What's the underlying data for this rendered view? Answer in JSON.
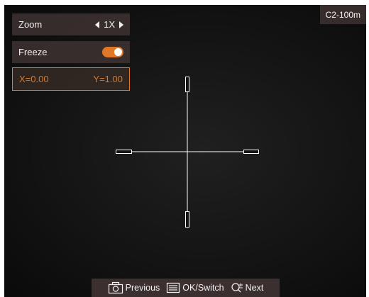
{
  "menu": {
    "zoom_label": "Zoom",
    "zoom_value": "1X",
    "freeze_label": "Freeze",
    "freeze_on": true,
    "x_value": "X=0.00",
    "y_value": "Y=1.00"
  },
  "profile_label": "C2-100m",
  "hints": {
    "previous": "Previous",
    "ok_switch": "OK/Switch",
    "next": "Next"
  },
  "colors": {
    "accent": "#e0782a",
    "panel": "#463737",
    "reticle": "#ffffff"
  }
}
